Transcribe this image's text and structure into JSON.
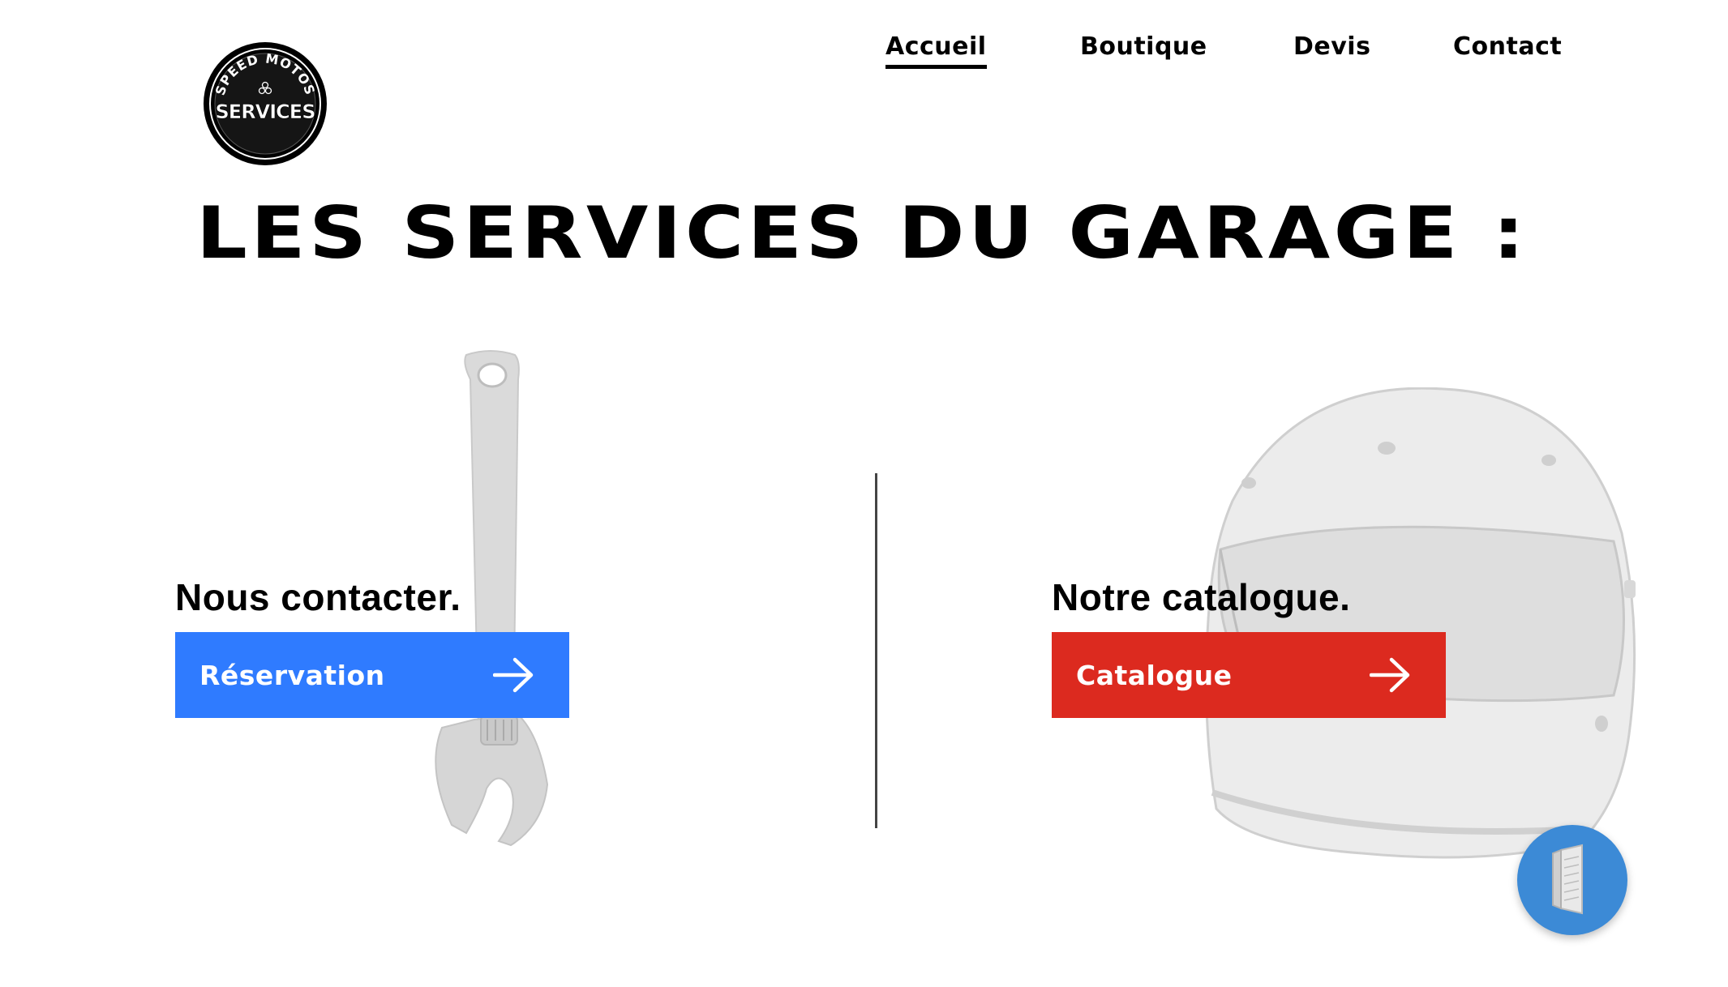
{
  "brand": {
    "logo_top_text": "SPEED MOTOS",
    "logo_bottom_text": "SERVICES"
  },
  "nav": {
    "items": [
      {
        "label": "Accueil",
        "active": true
      },
      {
        "label": "Boutique",
        "active": false
      },
      {
        "label": "Devis",
        "active": false
      },
      {
        "label": "Contact",
        "active": false
      }
    ]
  },
  "hero": {
    "title": "LES SERVICES DU GARAGE :"
  },
  "left_section": {
    "heading": "Nous contacter.",
    "button_label": "Réservation",
    "button_icon": "arrow-right-icon",
    "image": "wrench-icon"
  },
  "right_section": {
    "heading": "Notre catalogue.",
    "button_label": "Catalogue",
    "button_icon": "arrow-right-icon",
    "image": "helmet-icon"
  },
  "floating_button": {
    "icon": "door-icon"
  },
  "colors": {
    "reservation_button": "#2f7bff",
    "catalogue_button": "#dc2a1f",
    "floating_button": "#3c8ad6",
    "text": "#000000",
    "illustration": "#dcdcdc"
  }
}
